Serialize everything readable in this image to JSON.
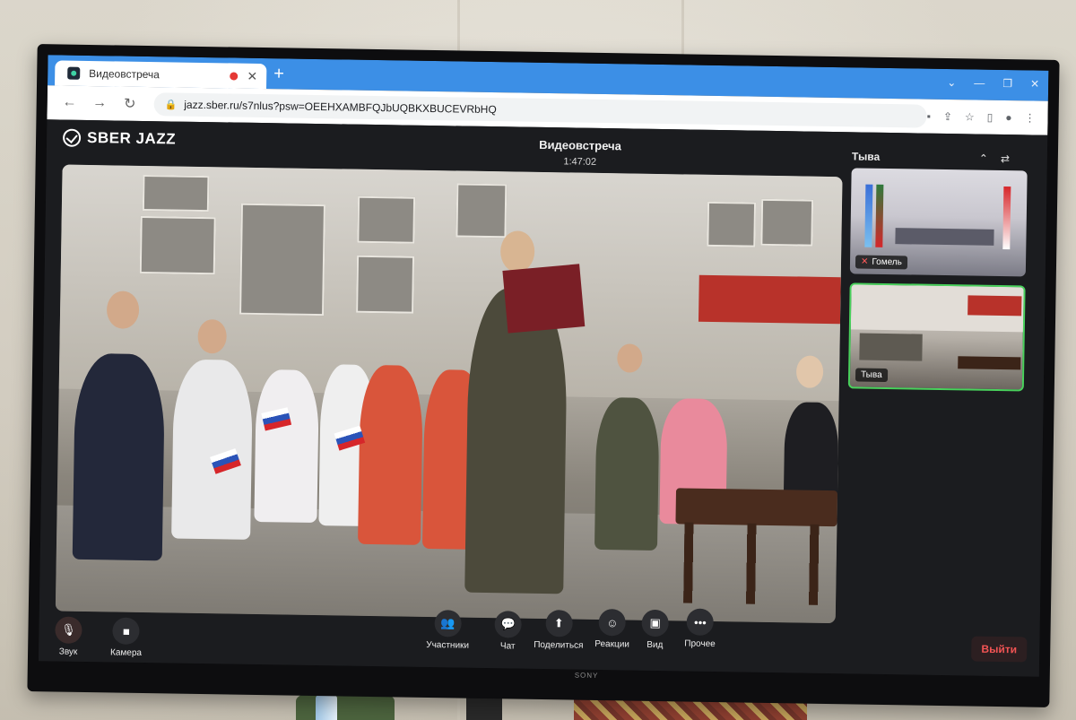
{
  "browser": {
    "tab_title": "Видеовстреча",
    "new_tab": "+",
    "url": "jazz.sber.ru/s7nlus?psw=OEEHXAMBFQJbUQBKXBUCEVRbHQ",
    "window_controls": [
      "⌄",
      "—",
      "❐",
      "✕"
    ]
  },
  "app": {
    "logo_text": "SBER JAZZ",
    "meeting_title": "Видеовстреча",
    "elapsed_time": "1:47:02",
    "side_panel_title": "Тыва"
  },
  "participants": [
    {
      "name": "Гомель",
      "muted": true
    },
    {
      "name": "Тыва",
      "muted": false,
      "active": true
    }
  ],
  "toolbar": {
    "sound_label": "Звук",
    "camera_label": "Камера",
    "participants_label": "Участники",
    "chat_label": "Чат",
    "share_label": "Поделиться",
    "reactions_label": "Реакции",
    "view_label": "Вид",
    "more_label": "Прочее",
    "leave_label": "Выйти"
  },
  "monitor": {
    "brand": "SONY"
  },
  "colors": {
    "tabstrip": "#3c8fe6",
    "app_bg": "#1b1c1f",
    "active_speaker_border": "#49d15c",
    "leave_text": "#f25454"
  },
  "icons": {
    "favicon": "sberjazz-favicon-icon",
    "record": "record-dot-icon",
    "close": "close-icon",
    "back": "arrow-left-icon",
    "forward": "arrow-right-icon",
    "reload": "reload-icon",
    "lock": "lock-icon",
    "collapse": "chevron-up-icon",
    "switch_layout": "switch-layout-icon",
    "mic_off": "mic-off-icon",
    "camera": "camera-icon",
    "participants": "people-icon",
    "chat": "chat-bubble-icon",
    "share": "share-screen-icon",
    "reactions": "smiley-icon",
    "view": "grid-view-icon",
    "more": "more-dots-icon"
  }
}
